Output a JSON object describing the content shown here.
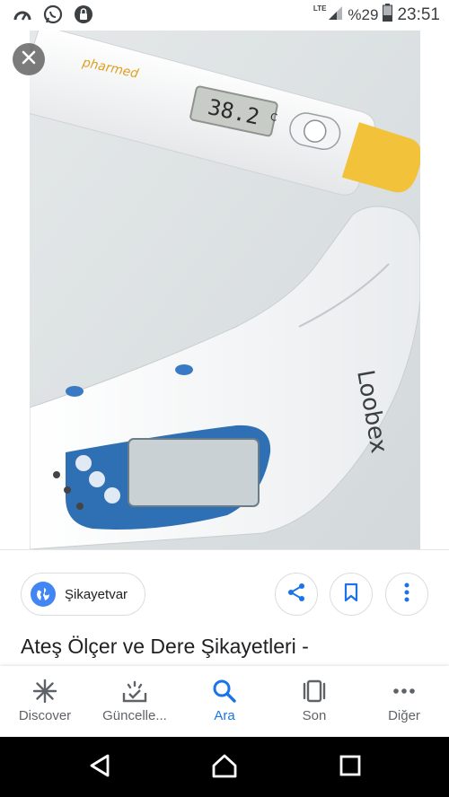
{
  "status": {
    "network": "LTE",
    "battery": "%29",
    "time": "23:51"
  },
  "photo": {
    "thermometer_brand": "pharmed",
    "thermometer_reading": "38.2",
    "thermometer_unit": "C",
    "device_brand": "Loobex"
  },
  "source": {
    "label": "Şikayetvar"
  },
  "result": {
    "title": "Ateş Ölçer ve Dere Şikayetleri -"
  },
  "nav": {
    "items": [
      {
        "label": "Discover",
        "icon": "asterisk-icon"
      },
      {
        "label": "Güncelle...",
        "icon": "updates-icon"
      },
      {
        "label": "Ara",
        "icon": "search-icon"
      },
      {
        "label": "Son",
        "icon": "recent-icon"
      },
      {
        "label": "Diğer",
        "icon": "more-icon"
      }
    ],
    "active_color": "#1a73e8",
    "inactive_color": "#5f6368"
  }
}
